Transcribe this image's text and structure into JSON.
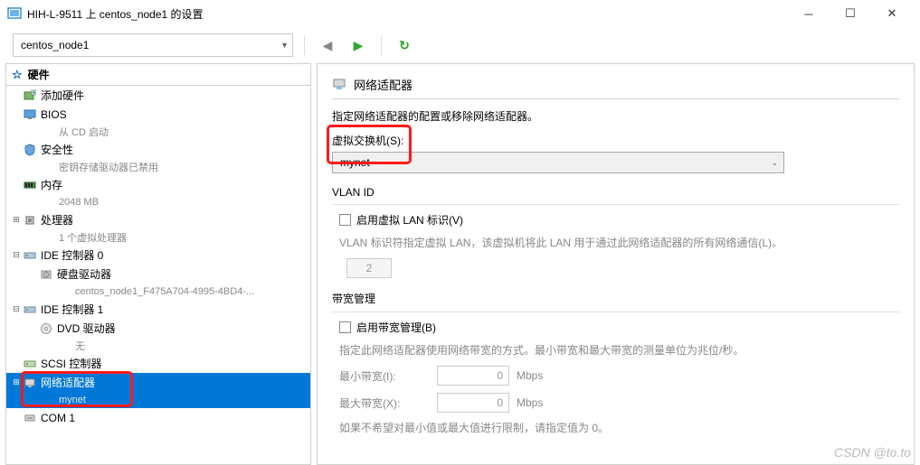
{
  "titlebar": {
    "title": "HIH-L-9511 上 centos_node1 的设置"
  },
  "toolbar": {
    "vm": "centos_node1"
  },
  "sidebar": {
    "header": "硬件",
    "items": [
      {
        "label": "添加硬件",
        "sub": "",
        "icon": "add"
      },
      {
        "label": "BIOS",
        "sub": "从 CD 启动",
        "icon": "monitor"
      },
      {
        "label": "安全性",
        "sub": "密钥存储驱动器已禁用",
        "icon": "shield"
      },
      {
        "label": "内存",
        "sub": "2048 MB",
        "icon": "ram"
      },
      {
        "label": "处理器",
        "sub": "1 个虚拟处理器",
        "icon": "cpu",
        "expand": "+"
      },
      {
        "label": "IDE 控制器 0",
        "sub": "",
        "icon": "ide",
        "expand": "-"
      },
      {
        "label": "硬盘驱动器",
        "sub": "centos_node1_F475A704-4995-4BD4-...",
        "icon": "hdd",
        "indent": 1
      },
      {
        "label": "IDE 控制器 1",
        "sub": "",
        "icon": "ide",
        "expand": "-"
      },
      {
        "label": "DVD 驱动器",
        "sub": "无",
        "icon": "dvd",
        "indent": 1
      },
      {
        "label": "SCSI 控制器",
        "sub": "",
        "icon": "scsi"
      },
      {
        "label": "网络适配器",
        "sub": "mynet",
        "icon": "nic",
        "expand": "+",
        "selected": true
      },
      {
        "label": "COM 1",
        "sub": "",
        "icon": "com"
      }
    ]
  },
  "main": {
    "title": "网络适配器",
    "desc": "指定网络适配器的配置或移除网络适配器。",
    "switch_label": "虚拟交换机(S):",
    "switch_value": "mynet",
    "vlan_group": "VLAN ID",
    "vlan_enable": "启用虚拟 LAN 标识(V)",
    "vlan_help": "VLAN 标识符指定虚拟 LAN，该虚拟机将此 LAN 用于通过此网络适配器的所有网络通信(L)。",
    "vlan_value": "2",
    "bw_group": "带宽管理",
    "bw_enable": "启用带宽管理(B)",
    "bw_help": "指定此网络适配器使用网络带宽的方式。最小带宽和最大带宽的测量单位为兆位/秒。",
    "bw_min_label": "最小带宽(I):",
    "bw_max_label": "最大带宽(X):",
    "bw_min_value": "0",
    "bw_max_value": "0",
    "bw_unit": "Mbps",
    "footer_hint": "如果不希望对最小值或最大值进行限制，请指定值为 0。"
  },
  "watermark": "CSDN @to.to"
}
